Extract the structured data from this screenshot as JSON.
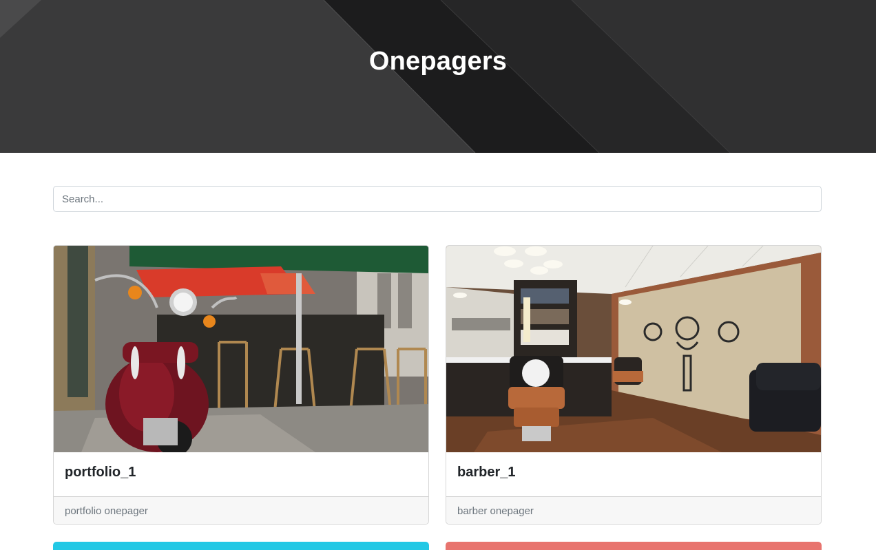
{
  "hero": {
    "title": "Onepagers"
  },
  "search": {
    "placeholder": "Search...",
    "value": ""
  },
  "cards": [
    {
      "title": "portfolio_1",
      "description": "portfolio onepager",
      "image": "red-scooter-street-cafe-photo"
    },
    {
      "title": "barber_1",
      "description": "barber onepager",
      "image": "barbershop-interior-photo"
    }
  ],
  "colors": {
    "hero_bg": "#2a2a2b",
    "card_footer_bg": "#f7f7f7",
    "next_card_1_accent": "#22c8e5",
    "next_card_2_accent": "#e8746e"
  }
}
